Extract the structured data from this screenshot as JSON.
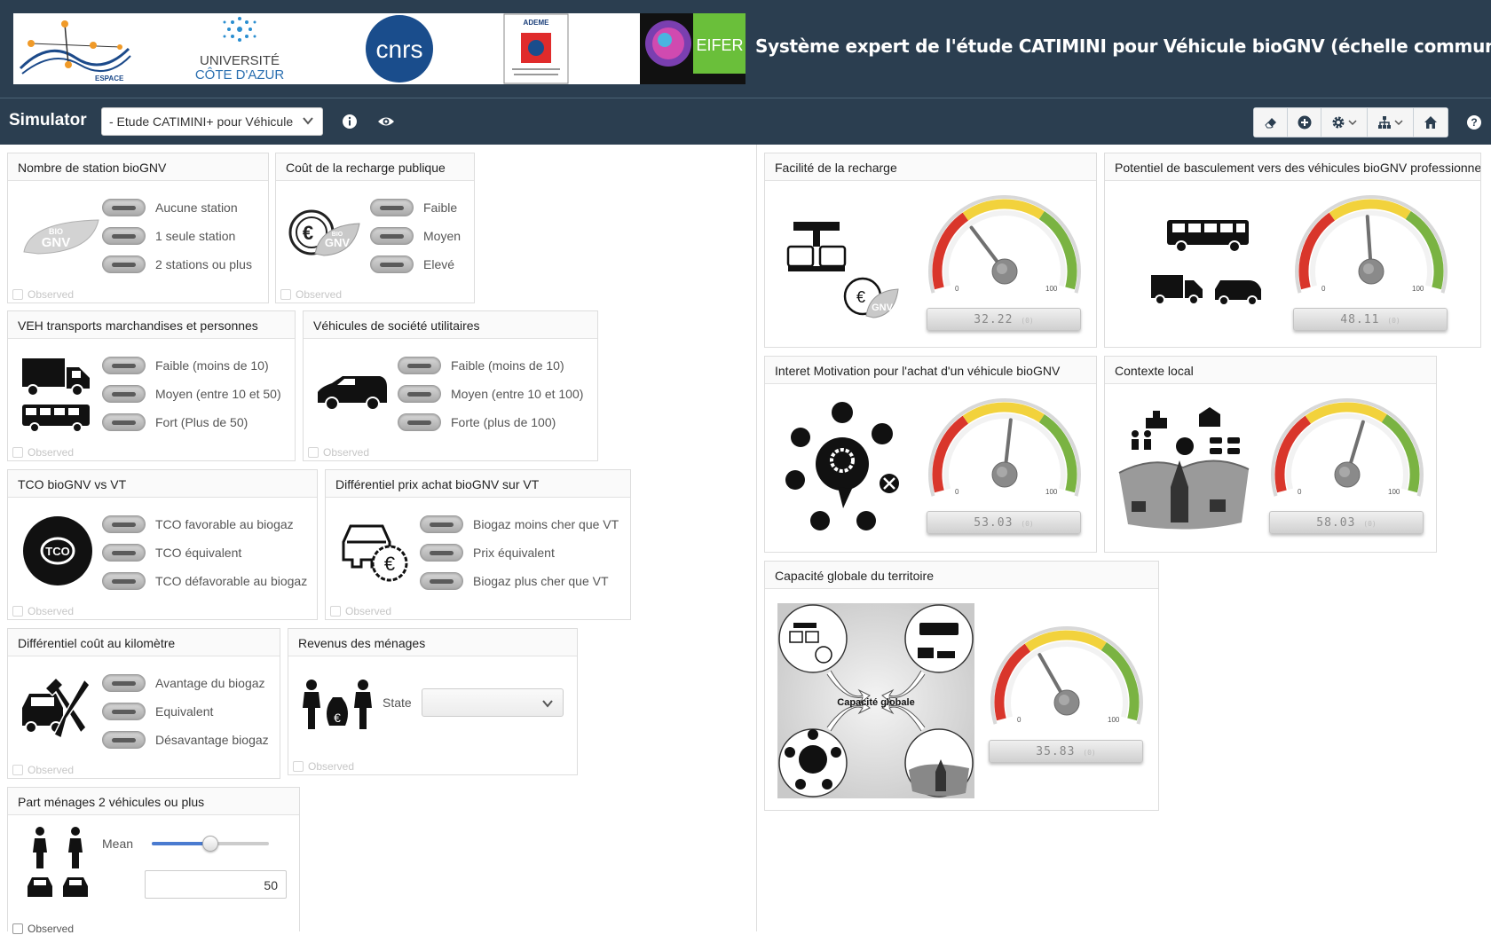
{
  "header": {
    "title": "Système expert de l'étude CATIMINI pour Véhicule bioGNV (échelle communale)",
    "logos": {
      "espace": "ESPACE",
      "universite_line1": "UNIVERSITÉ",
      "universite_line2": "CÔTE D'AZUR",
      "cnrs": "cnrs",
      "ademe": "ADEME",
      "eifer": "EIFER"
    }
  },
  "toolbar": {
    "title": "Simulator",
    "simulation_select": "- Etude CATIMINI+ pour Véhicule",
    "icons": [
      "info-icon",
      "eye-icon",
      "eraser-icon",
      "plus-circle-icon",
      "gear-icon",
      "hierarchy-icon",
      "home-icon",
      "help-icon"
    ]
  },
  "observed_label": "Observed",
  "cards": {
    "stations": {
      "title": "Nombre de station bioGNV",
      "options": [
        "Aucune station",
        "1 seule station",
        "2 stations ou plus"
      ]
    },
    "cout_recharge": {
      "title": "Coût de la recharge publique",
      "options": [
        "Faible",
        "Moyen",
        "Elevé"
      ]
    },
    "veh_transports": {
      "title": "VEH transports marchandises et personnes",
      "options": [
        "Faible (moins de 10)",
        "Moyen (entre 10 et 50)",
        "Fort (Plus de 50)"
      ]
    },
    "veh_societe": {
      "title": "Véhicules de société utilitaires",
      "options": [
        "Faible (moins de 10)",
        "Moyen (entre 10 et 100)",
        "Forte (plus de 100)"
      ]
    },
    "tco": {
      "title": "TCO bioGNV vs VT",
      "options": [
        "TCO favorable au biogaz",
        "TCO équivalent",
        "TCO défavorable au biogaz"
      ]
    },
    "diff_prix": {
      "title": "Différentiel prix achat bioGNV sur VT",
      "options": [
        "Biogaz moins cher que VT",
        "Prix équivalent",
        "Biogaz plus cher que VT"
      ]
    },
    "diff_cout_km": {
      "title": "Différentiel coût au kilomètre",
      "options": [
        "Avantage du biogaz",
        "Equivalent",
        "Désavantage biogaz"
      ]
    },
    "revenus": {
      "title": "Revenus des ménages",
      "state_label": "State",
      "state_value": ""
    },
    "part_menages": {
      "title": "Part ménages 2 véhicules ou plus",
      "mean_label": "Mean",
      "value": "50",
      "slider_fraction": 0.5
    }
  },
  "gauges": {
    "facilite": {
      "title": "Facilité de la recharge",
      "value": "32.22",
      "unit": "(0)",
      "fraction": 0.3222
    },
    "potentiel": {
      "title": "Potentiel de basculement vers des véhicules bioGNV professionnel",
      "value": "48.11",
      "unit": "(0)",
      "fraction": 0.4811
    },
    "interet": {
      "title": "Interet Motivation pour l'achat d'un véhicule bioGNV",
      "value": "53.03",
      "unit": "(0)",
      "fraction": 0.5303
    },
    "contexte": {
      "title": "Contexte local",
      "value": "58.03",
      "unit": "(0)",
      "fraction": 0.5803
    },
    "capacite": {
      "title": "Capacité globale du territoire",
      "value": "35.83",
      "unit": "(0)",
      "fraction": 0.3583,
      "diagram_label": "Capacité globale"
    }
  },
  "gauge_scale": {
    "min": "0",
    "max": "100"
  },
  "icon_labels": {
    "bio": "BIO",
    "gnv": "GNV",
    "tco": "TCO"
  },
  "colors": {
    "header_bg": "#2b3e50",
    "gauge_red": "#d9362b",
    "gauge_yellow": "#f2d23c",
    "gauge_green": "#7ab342"
  }
}
